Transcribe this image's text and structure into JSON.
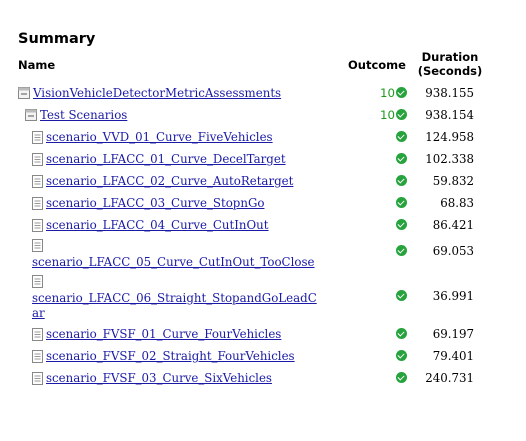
{
  "page": {
    "title": "Summary"
  },
  "headers": {
    "name": "Name",
    "outcome": "Outcome",
    "duration_line1": "Duration",
    "duration_line2": "(Seconds)"
  },
  "rows": [
    {
      "name": "VisionVehicleDetectorMetricAssessments",
      "count": "10",
      "duration": "938.155",
      "icon": "collapse-folder-icon"
    },
    {
      "name": "Test Scenarios",
      "count": "10",
      "duration": "938.154",
      "icon": "collapse-folder-icon"
    },
    {
      "name": "scenario_VVD_01_Curve_FiveVehicles",
      "count": "",
      "duration": "124.958",
      "icon": "document-icon"
    },
    {
      "name": "scenario_LFACC_01_Curve_DecelTarget",
      "count": "",
      "duration": "102.338",
      "icon": "document-icon"
    },
    {
      "name": "scenario_LFACC_02_Curve_AutoRetarget",
      "count": "",
      "duration": "59.832",
      "icon": "document-icon"
    },
    {
      "name": "scenario_LFACC_03_Curve_StopnGo",
      "count": "",
      "duration": "68.83",
      "icon": "document-icon"
    },
    {
      "name": "scenario_LFACC_04_Curve_CutInOut",
      "count": "",
      "duration": "86.421",
      "icon": "document-icon"
    },
    {
      "name": "scenario_LFACC_05_Curve_CutInOut_TooClose",
      "count": "",
      "duration": "69.053",
      "icon": "document-icon"
    },
    {
      "name_line1": "scenario_LFACC_06_Straight_StopandGoLeadC",
      "name_line2": "ar",
      "count": "",
      "duration": "36.991",
      "icon": "document-icon"
    },
    {
      "name": "scenario_FVSF_01_Curve_FourVehicles",
      "count": "",
      "duration": "69.197",
      "icon": "document-icon"
    },
    {
      "name": "scenario_FVSF_02_Straight_FourVehicles",
      "count": "",
      "duration": "79.401",
      "icon": "document-icon"
    },
    {
      "name": "scenario_FVSF_03_Curve_SixVehicles",
      "count": "",
      "duration": "240.731",
      "icon": "document-icon"
    }
  ],
  "colors": {
    "link": "#1a1aa6",
    "pass": "#27a33d",
    "count": "#1e9a1e"
  }
}
